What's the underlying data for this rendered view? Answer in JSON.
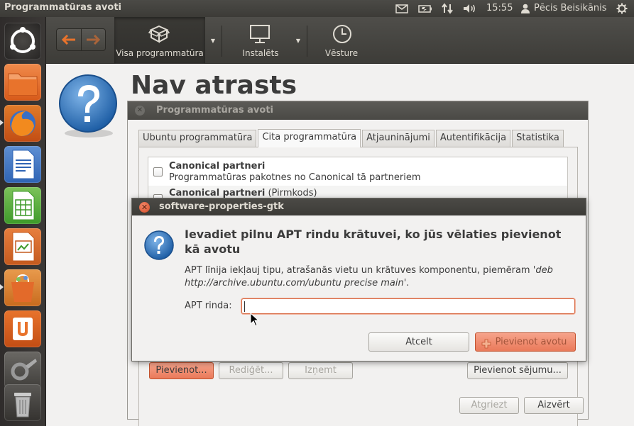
{
  "top_panel": {
    "title": "Programmatūras avoti",
    "clock": "15:55",
    "user": "Pēcis Beisikānis",
    "icons": [
      "mail-icon",
      "battery-icon",
      "network-icon",
      "volume-icon",
      "user-icon",
      "power-gear-icon"
    ]
  },
  "launcher": {
    "items": [
      "ubuntu-dash-icon",
      "home-folder-icon",
      "firefox-icon",
      "libreoffice-writer-icon",
      "libreoffice-calc-icon",
      "libreoffice-impress-icon",
      "software-center-icon",
      "ubuntu-one-icon",
      "system-settings-icon",
      "trash-icon"
    ]
  },
  "toolbar": {
    "all_software": "Visa programmatūra",
    "installed": "Instalēts",
    "history": "Vēsture"
  },
  "main": {
    "heading": "Nav atrasts"
  },
  "sources": {
    "title": "Programmatūras avoti",
    "tabs": [
      "Ubuntu programmatūra",
      "Cita programmatūra",
      "Atjauninājumi",
      "Autentifikācija",
      "Statistika"
    ],
    "rows": [
      {
        "title": "Canonical partneri",
        "subtitle": "Programmatūras pakotnes no Canonical tā partneriem"
      },
      {
        "title": "Canonical partneri",
        "suffix": " (Pirmkods)"
      }
    ],
    "buttons": {
      "add": "Pievienot...",
      "edit": "Rediģēt...",
      "remove": "Izņemt",
      "add_volume": "Pievienot sējumu...",
      "revert": "Atgriezt",
      "close": "Aizvērt"
    }
  },
  "apt_dialog": {
    "title": "software-properties-gtk",
    "heading": "Ievadiet pilnu APT rindu krātuvei, ko jūs vēlaties pievienot kā avotu",
    "desc_pre": "APT līnija iekļauj tipu, atrašanās vietu un krātuves komponentu, piemēram '",
    "desc_example": "deb http://archive.ubuntu.com/ubuntu precise main",
    "desc_post": "'.",
    "label": "APT rinda:",
    "input_value": "",
    "cancel": "Atcelt",
    "add_source": "Pievienot avotu"
  },
  "colors": {
    "accent": "#e8732c",
    "panel": "#3c3b37",
    "focus_border": "#d86b45"
  }
}
